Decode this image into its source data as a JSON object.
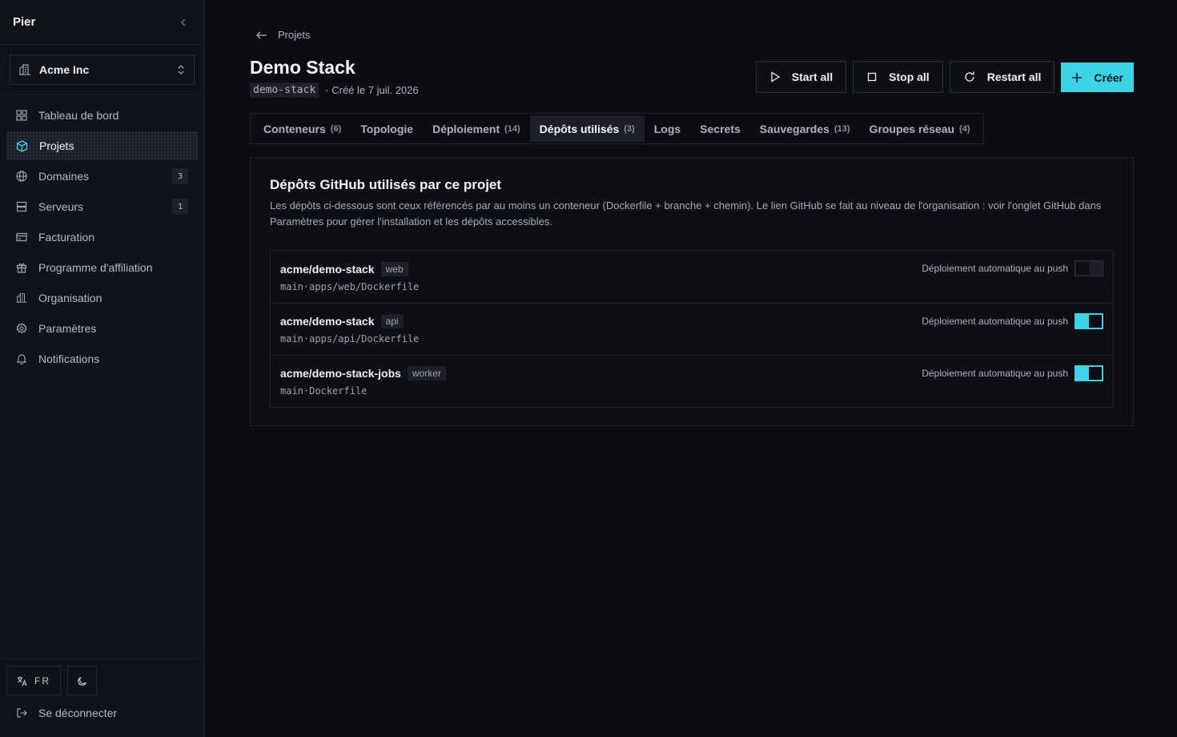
{
  "app": {
    "name": "Pier"
  },
  "org": {
    "name": "Acme Inc"
  },
  "sidebar": {
    "items": [
      {
        "label": "Tableau de bord",
        "icon": "grid-icon"
      },
      {
        "label": "Projets",
        "icon": "box-icon",
        "active": true
      },
      {
        "label": "Domaines",
        "icon": "globe-icon",
        "count": "3"
      },
      {
        "label": "Serveurs",
        "icon": "server-icon",
        "count": "1"
      },
      {
        "label": "Facturation",
        "icon": "card-icon"
      },
      {
        "label": "Programme d'affiliation",
        "icon": "gift-icon"
      },
      {
        "label": "Organisation",
        "icon": "building-icon"
      },
      {
        "label": "Paramètres",
        "icon": "gear-icon"
      },
      {
        "label": "Notifications",
        "icon": "bell-icon"
      }
    ],
    "language": "FR",
    "logout": "Se déconnecter"
  },
  "breadcrumb": {
    "back_label": "Projets"
  },
  "project": {
    "title": "Demo Stack",
    "slug": "demo-stack",
    "created": "· Créé le 7 juil. 2026"
  },
  "actions": {
    "start": "Start all",
    "stop": "Stop all",
    "restart": "Restart all",
    "create": "Créer"
  },
  "tabs": [
    {
      "label": "Conteneurs",
      "count": "(6)"
    },
    {
      "label": "Topologie",
      "count": ""
    },
    {
      "label": "Déploiement",
      "count": "(14)"
    },
    {
      "label": "Dépôts utilisés",
      "count": "(3)",
      "active": true
    },
    {
      "label": "Logs",
      "count": ""
    },
    {
      "label": "Secrets",
      "count": ""
    },
    {
      "label": "Sauvegardes",
      "count": "(13)"
    },
    {
      "label": "Groupes réseau",
      "count": "(4)"
    }
  ],
  "panel": {
    "title": "Dépôts GitHub utilisés par ce projet",
    "description": "Les dépôts ci-dessous sont ceux référencés par au moins un conteneur (Dockerfile + branche + chemin). Le lien GitHub se fait au niveau de l'organisation : voir l'onglet GitHub dans Paramètres pour gérer l'installation et les dépôts accessibles.",
    "auto_label": "Déploiement automatique au push"
  },
  "repos": [
    {
      "name": "acme/demo-stack",
      "tag": "web",
      "branch": "main",
      "path": "apps/web/Dockerfile",
      "auto_deploy": false
    },
    {
      "name": "acme/demo-stack",
      "tag": "api",
      "branch": "main",
      "path": "apps/api/Dockerfile",
      "auto_deploy": true
    },
    {
      "name": "acme/demo-stack-jobs",
      "tag": "worker",
      "branch": "main",
      "path": "Dockerfile",
      "auto_deploy": true
    }
  ],
  "colors": {
    "accent": "#3bd4e6",
    "background": "#0b0d13",
    "sidebar": "#11131a"
  }
}
